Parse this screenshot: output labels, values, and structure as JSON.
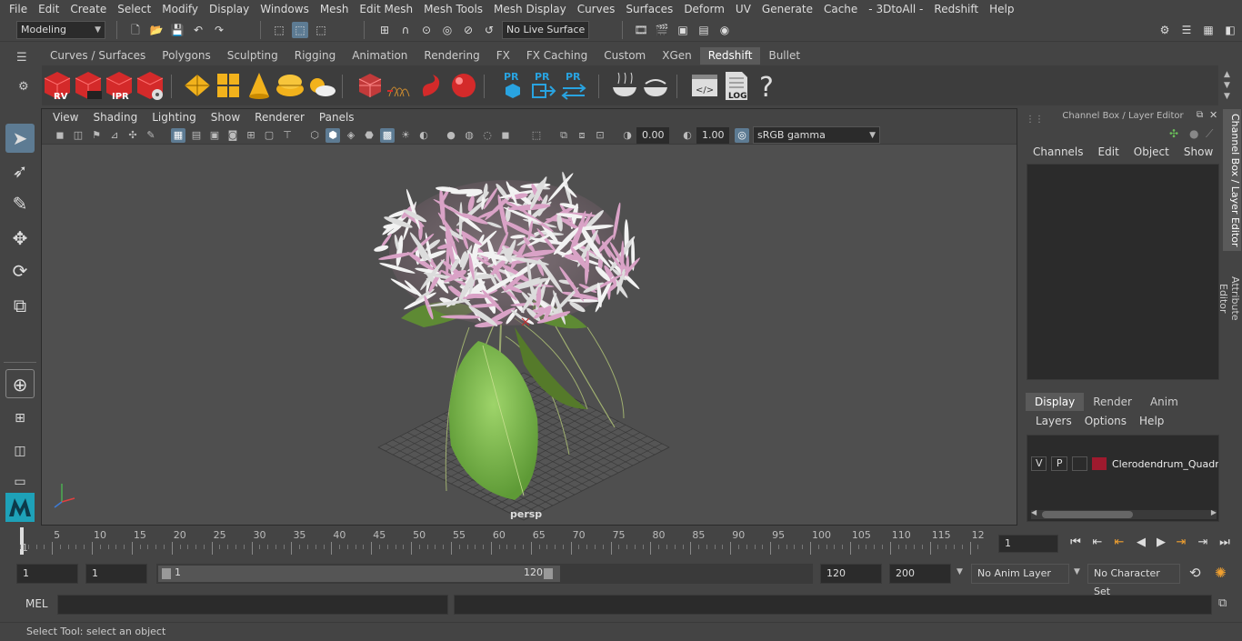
{
  "menubar": [
    "File",
    "Edit",
    "Create",
    "Select",
    "Modify",
    "Display",
    "Windows",
    "Mesh",
    "Edit Mesh",
    "Mesh Tools",
    "Mesh Display",
    "Curves",
    "Surfaces",
    "Deform",
    "UV",
    "Generate",
    "Cache",
    "- 3DtoAll -",
    "Redshift",
    "Help"
  ],
  "status": {
    "workspace": "Modeling",
    "live_surface": "No Live Surface"
  },
  "shelf_tabs": [
    "Curves / Surfaces",
    "Polygons",
    "Sculpting",
    "Rigging",
    "Animation",
    "Rendering",
    "FX",
    "FX Caching",
    "Custom",
    "XGen",
    "Redshift",
    "Bullet"
  ],
  "shelf_active": "Redshift",
  "shelf_labels": {
    "rv": "RV",
    "ipr": "IPR",
    "pr1": "PR",
    "pr2": "PR",
    "pr3": "PR",
    "log": "LOG",
    "help": "?"
  },
  "viewport": {
    "menu": [
      "View",
      "Shading",
      "Lighting",
      "Show",
      "Renderer",
      "Panels"
    ],
    "exposure": "0.00",
    "gamma": "1.00",
    "colorspace": "sRGB gamma",
    "camera": "persp"
  },
  "channelbox": {
    "title": "Channel Box / Layer Editor",
    "menu": [
      "Channels",
      "Edit",
      "Object",
      "Show"
    ],
    "layer_tabs": [
      "Display",
      "Render",
      "Anim"
    ],
    "layer_active": "Display",
    "layer_menu": [
      "Layers",
      "Options",
      "Help"
    ],
    "layer": {
      "v": "V",
      "p": "P",
      "name": "Clerodendrum_Quadri",
      "color": "#9e1a2e"
    }
  },
  "side_tabs": [
    "Channel Box / Layer Editor",
    "Attribute Editor"
  ],
  "timeline": {
    "labels": [
      "5",
      "10",
      "15",
      "20",
      "25",
      "30",
      "35",
      "40",
      "45",
      "50",
      "55",
      "60",
      "65",
      "70",
      "75",
      "80",
      "85",
      "90",
      "95",
      "100",
      "105",
      "110",
      "115",
      "12"
    ],
    "start_label": "1",
    "current": "1"
  },
  "range": {
    "start": "1",
    "start2": "1",
    "slider_start": "1",
    "slider_end": "120",
    "end": "120",
    "end2": "200",
    "anim_layer": "No Anim Layer",
    "char_set": "No Character Set"
  },
  "mel": {
    "label": "MEL"
  },
  "help_line": "Select Tool: select an object"
}
